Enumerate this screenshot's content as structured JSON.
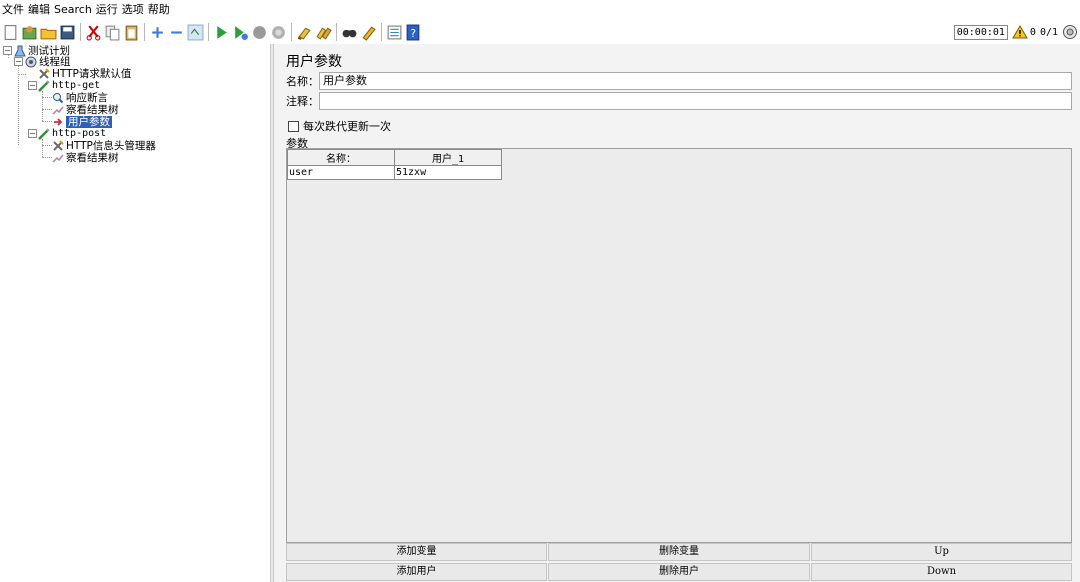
{
  "menubar": {
    "items": [
      "文件",
      "编辑",
      "Search",
      "运行",
      "选项",
      "帮助"
    ]
  },
  "toolbar": {
    "icons": [
      "new-icon",
      "templates-icon",
      "open-icon",
      "save-icon",
      "cut-icon",
      "copy-icon",
      "paste-icon",
      "expand-icon",
      "collapse-icon",
      "toggle-icon",
      "start-icon",
      "start-no-timers-icon",
      "stop-icon",
      "shutdown-icon",
      "clear-icon",
      "clear-all-icon",
      "search-icon",
      "reset-search-icon",
      "function-helper-icon",
      "help-icon"
    ],
    "timer": "00:00:01",
    "warning_count": "0",
    "threads": "0/1"
  },
  "tree": {
    "nodes": [
      {
        "label": "测试计划",
        "icon": "test-plan-icon",
        "mono": false
      },
      {
        "label": "线程组",
        "icon": "thread-group-icon",
        "mono": false
      },
      {
        "label": "HTTP请求默认值",
        "icon": "config-icon",
        "mono": false
      },
      {
        "label": "http-get",
        "icon": "sampler-icon",
        "mono": true
      },
      {
        "label": "响应断言",
        "icon": "assertion-icon",
        "mono": false
      },
      {
        "label": "察看结果树",
        "icon": "listener-icon",
        "mono": false
      },
      {
        "label": "用户参数",
        "icon": "preprocessor-icon",
        "mono": false,
        "selected": true
      },
      {
        "label": "http-post",
        "icon": "sampler-icon",
        "mono": true
      },
      {
        "label": "HTTP信息头管理器",
        "icon": "config-icon",
        "mono": false
      },
      {
        "label": "察看结果树",
        "icon": "listener-icon",
        "mono": false
      }
    ]
  },
  "panel": {
    "title": "用户参数",
    "name_label": "名称：",
    "name_value": "用户参数",
    "comment_label": "注释：",
    "comment_value": "",
    "checkbox_label": "每次跌代更新一次",
    "params_label": "参数"
  },
  "table": {
    "headers": [
      "名称：",
      "用户_1"
    ],
    "rows": [
      [
        "user",
        "51zxw"
      ]
    ]
  },
  "buttons": {
    "add_var": "添加变量",
    "del_var": "删除变量",
    "up": "Up",
    "add_user": "添加用户",
    "del_user": "删除用户",
    "down": "Down"
  }
}
